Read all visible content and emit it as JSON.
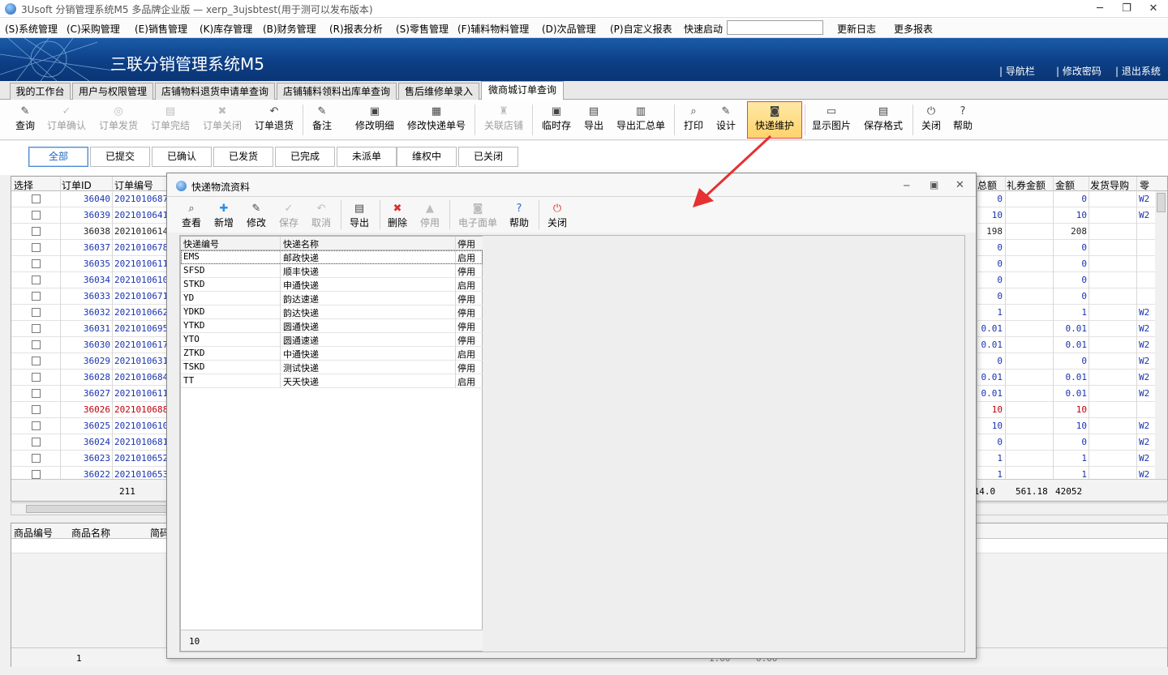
{
  "window": {
    "title": "3Usoft 分销管理系统M5 多品牌企业版 — xerp_3ujsbtest(用于测可以发布版本)"
  },
  "menu": {
    "items": [
      "(S)系统管理",
      "(C)采购管理",
      "(E)销售管理",
      "(K)库存管理",
      "(B)财务管理",
      "(R)报表分析",
      "(S)零售管理",
      "(F)辅料物料管理",
      "(D)次品管理",
      "(P)自定义报表"
    ],
    "quick_label": "快速启动",
    "quick_value": "",
    "update_log": "更新日志",
    "more_reports": "更多报表"
  },
  "banner": {
    "app_name": "三联分销管理系统M5",
    "links": [
      "导航栏",
      "修改密码",
      "退出系统"
    ]
  },
  "tabs": [
    "我的工作台",
    "用户与权限管理",
    "店铺物料退货申请单查询",
    "店铺辅料领料出库单查询",
    "售后维修单录入",
    "微商城订单查询"
  ],
  "toolbar": {
    "buttons": [
      "查询",
      "订单确认",
      "订单发货",
      "订单完结",
      "订单关闭",
      "订单退货",
      "备注",
      "修改明细",
      "修改快递单号",
      "关联店铺",
      "临时存",
      "导出",
      "导出汇总单",
      "打印",
      "设计",
      "快递维护",
      "显示图片",
      "保存格式",
      "关闭",
      "帮助"
    ]
  },
  "filters": [
    "全部",
    "已提交",
    "已确认",
    "已发货",
    "已完成",
    "未派单",
    "维权中",
    "已关闭"
  ],
  "grid": {
    "headers_left": [
      "选择",
      "订单ID",
      "订单编号"
    ],
    "headers_right": [
      "总额",
      "礼券金额",
      "金额",
      "发货导购",
      "零"
    ],
    "rows": [
      {
        "id": "36040",
        "no": "20210106871",
        "total": "0",
        "gift": "",
        "amount": "0",
        "guide": "",
        "z": "W2",
        "color": "blue"
      },
      {
        "id": "36039",
        "no": "20210106413",
        "total": "10",
        "gift": "",
        "amount": "10",
        "guide": "",
        "z": "W2",
        "color": "blue"
      },
      {
        "id": "36038",
        "no": "20210106140",
        "total": "198",
        "gift": "",
        "amount": "208",
        "guide": "",
        "z": "",
        "color": "dark"
      },
      {
        "id": "36037",
        "no": "20210106784",
        "total": "0",
        "gift": "",
        "amount": "0",
        "guide": "",
        "z": "",
        "color": "blue"
      },
      {
        "id": "36035",
        "no": "20210106110",
        "total": "0",
        "gift": "",
        "amount": "0",
        "guide": "",
        "z": "",
        "color": "blue"
      },
      {
        "id": "36034",
        "no": "20210106105",
        "total": "0",
        "gift": "",
        "amount": "0",
        "guide": "",
        "z": "",
        "color": "blue"
      },
      {
        "id": "36033",
        "no": "20210106719",
        "total": "0",
        "gift": "",
        "amount": "0",
        "guide": "",
        "z": "",
        "color": "blue"
      },
      {
        "id": "36032",
        "no": "20210106624",
        "total": "1",
        "gift": "",
        "amount": "1",
        "guide": "",
        "z": "W2",
        "color": "blue"
      },
      {
        "id": "36031",
        "no": "20210106958",
        "total": "0.01",
        "gift": "",
        "amount": "0.01",
        "guide": "",
        "z": "W2",
        "color": "blue"
      },
      {
        "id": "36030",
        "no": "20210106173",
        "total": "0.01",
        "gift": "",
        "amount": "0.01",
        "guide": "",
        "z": "W2",
        "color": "blue"
      },
      {
        "id": "36029",
        "no": "20210106310",
        "total": "0",
        "gift": "",
        "amount": "0",
        "guide": "",
        "z": "W2",
        "color": "blue"
      },
      {
        "id": "36028",
        "no": "20210106841",
        "total": "0.01",
        "gift": "",
        "amount": "0.01",
        "guide": "",
        "z": "W2",
        "color": "blue"
      },
      {
        "id": "36027",
        "no": "20210106110",
        "total": "0.01",
        "gift": "",
        "amount": "0.01",
        "guide": "",
        "z": "W2",
        "color": "blue"
      },
      {
        "id": "36026",
        "no": "20210106887",
        "total": "10",
        "gift": "",
        "amount": "10",
        "guide": "",
        "z": "",
        "color": "red"
      },
      {
        "id": "36025",
        "no": "20210106109",
        "total": "10",
        "gift": "",
        "amount": "10",
        "guide": "",
        "z": "W2",
        "color": "blue"
      },
      {
        "id": "36024",
        "no": "20210106816",
        "total": "0",
        "gift": "",
        "amount": "0",
        "guide": "",
        "z": "W2",
        "color": "blue"
      },
      {
        "id": "36023",
        "no": "20210106526",
        "total": "1",
        "gift": "",
        "amount": "1",
        "guide": "",
        "z": "W2",
        "color": "blue"
      },
      {
        "id": "36022",
        "no": "20210106536",
        "total": "1",
        "gift": "",
        "amount": "1",
        "guide": "",
        "z": "W2",
        "color": "blue"
      }
    ],
    "footer": {
      "count": "211",
      "total": "014.0",
      "gift": "561.18",
      "amount": "42052"
    }
  },
  "lower": {
    "headers": [
      "商品编号",
      "商品名称",
      "简码"
    ],
    "footer_count": "1",
    "footer_a": "1.00",
    "footer_b": "0.00"
  },
  "dialog": {
    "title": "快递物流资料",
    "toolbar": [
      "查看",
      "新增",
      "修改",
      "保存",
      "取消",
      "导出",
      "删除",
      "停用",
      "电子面单",
      "帮助",
      "关闭"
    ],
    "headers": [
      "快递编号",
      "快递名称",
      "停用"
    ],
    "rows": [
      {
        "code": "EMS",
        "name": "邮政快递",
        "status": "启用"
      },
      {
        "code": "SFSD",
        "name": "顺丰快递",
        "status": "停用"
      },
      {
        "code": "STKD",
        "name": "申通快递",
        "status": "启用"
      },
      {
        "code": "YD",
        "name": "韵达速递",
        "status": "停用"
      },
      {
        "code": "YDKD",
        "name": "韵达快递",
        "status": "停用"
      },
      {
        "code": "YTKD",
        "name": "圆通快递",
        "status": "停用"
      },
      {
        "code": "YTO",
        "name": "圆通速递",
        "status": "停用"
      },
      {
        "code": "ZTKD",
        "name": "中通快递",
        "status": "启用"
      },
      {
        "code": "TSKD",
        "name": "测试快递",
        "status": "停用"
      },
      {
        "code": "TT",
        "name": "天天快递",
        "status": "启用"
      }
    ],
    "footer_count": "10"
  },
  "colors": {
    "blue_text": "#1a33b0",
    "red_text": "#c0000a",
    "banner": "#0f4a96",
    "highlight": "#ffd36b",
    "arrow": "#e53131"
  },
  "icons": [
    "app-globe-icon",
    "minimize-icon",
    "restore-icon",
    "close-icon",
    "search-icon",
    "check-icon",
    "arrow-icon"
  ]
}
